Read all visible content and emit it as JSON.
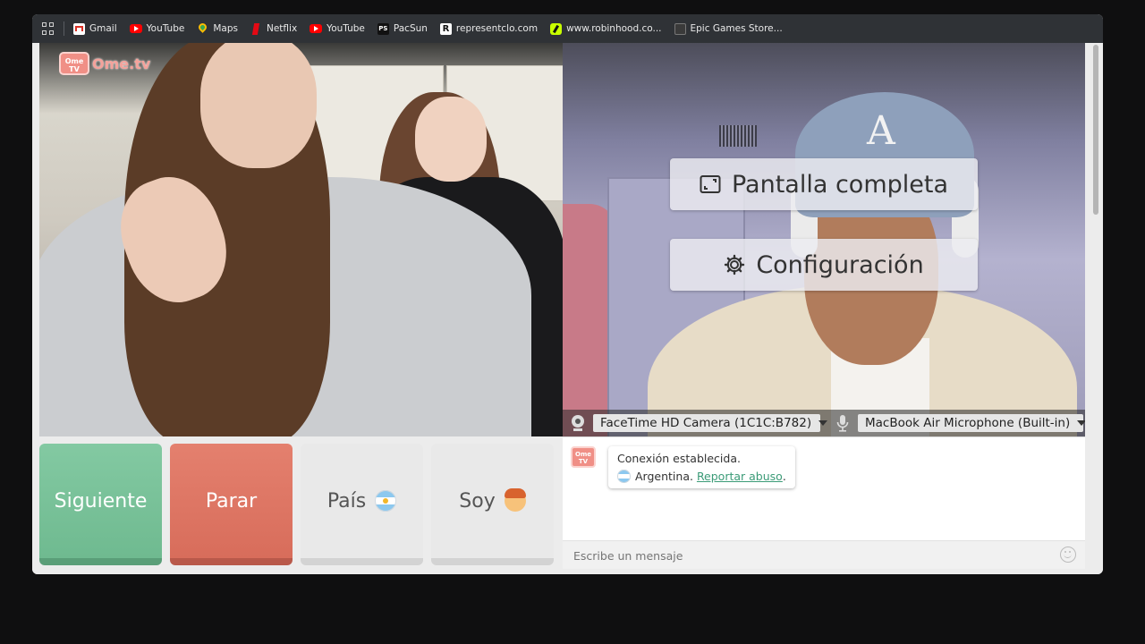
{
  "bookmarks": [
    {
      "label": "Gmail",
      "icon": "gmail-icon"
    },
    {
      "label": "YouTube",
      "icon": "youtube-icon"
    },
    {
      "label": "Maps",
      "icon": "maps-icon"
    },
    {
      "label": "Netflix",
      "icon": "netflix-icon"
    },
    {
      "label": "YouTube",
      "icon": "youtube-icon"
    },
    {
      "label": "PacSun",
      "icon": "pacsun-icon"
    },
    {
      "label": "representclo.com",
      "icon": "represent-icon"
    },
    {
      "label": "www.robinhood.co...",
      "icon": "robinhood-icon"
    },
    {
      "label": "Epic Games Store...",
      "icon": "epic-games-icon"
    }
  ],
  "logo": {
    "badge": "Ome TV",
    "text": "Ome.tv"
  },
  "overlay": {
    "fullscreen_label": "Pantalla completa",
    "settings_label": "Configuración"
  },
  "devices": {
    "camera": "FaceTime HD Camera (1C1C:B782)",
    "microphone": "MacBook Air Microphone (Built-in)"
  },
  "controls": {
    "next_label": "Siguiente",
    "stop_label": "Parar",
    "country_label": "País",
    "me_label": "Soy"
  },
  "chat": {
    "badge": "Ome TV",
    "status": "Conexión establecida.",
    "country": "Argentina.",
    "report_link": "Reportar abuso",
    "report_suffix": ".",
    "input_placeholder": "Escribe un mensaje"
  },
  "colors": {
    "next": "#76be95",
    "stop": "#dd7462",
    "link": "#3b9b77",
    "brand": "#f08f86"
  }
}
